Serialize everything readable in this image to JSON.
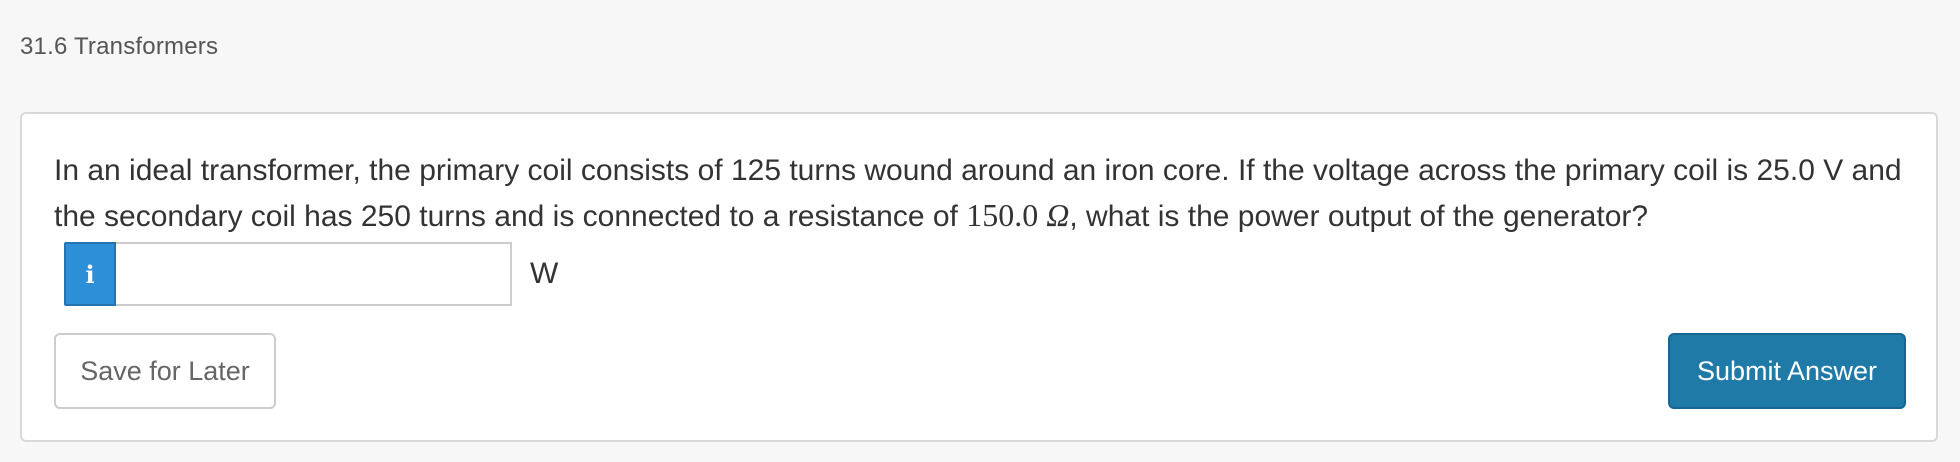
{
  "header": {
    "section_title": "31.6 Transformers"
  },
  "question": {
    "text_before": "In an ideal transformer, the primary coil consists of 125 turns wound around an iron core. If the voltage across the primary coil is 25.0 V and the secondary coil has 250 turns and is connected to a resistance of ",
    "resistance_value": "150.0",
    "resistance_unit": "Ω",
    "text_after": ", what is the power output of the generator?"
  },
  "answer": {
    "info_icon": "info-icon",
    "info_glyph": "i",
    "input_value": "",
    "unit": "W"
  },
  "actions": {
    "save_label": "Save for Later",
    "submit_label": "Submit Answer"
  },
  "colors": {
    "info_blue": "#2d8fd8",
    "submit_blue": "#1f7aa8",
    "page_background": "#f7f7f7"
  }
}
